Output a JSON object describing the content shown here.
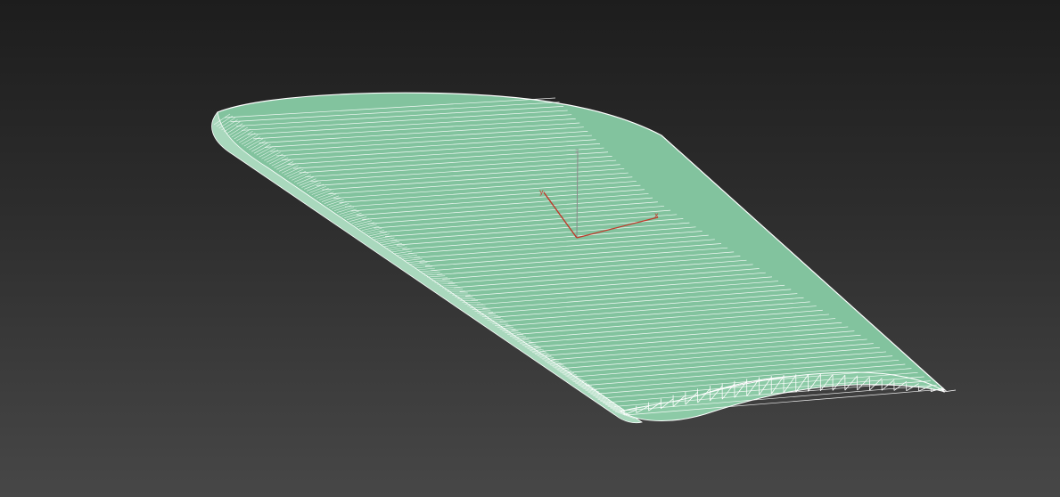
{
  "viewport": {
    "background_top": "#1d1d1d",
    "background_bottom": "#474747"
  },
  "model": {
    "object": "wing-airfoil-mesh",
    "display_mode": "wireframe-over-shaded",
    "fill_color": "#82c39e",
    "edge_color": "#ffffff"
  },
  "gizmo": {
    "x_axis_color": "#c0392b",
    "y_axis_color": "#c0392b",
    "z_axis_color": "#8a8a8a",
    "x_label": "x",
    "y_label": "y",
    "z_label": "z"
  }
}
